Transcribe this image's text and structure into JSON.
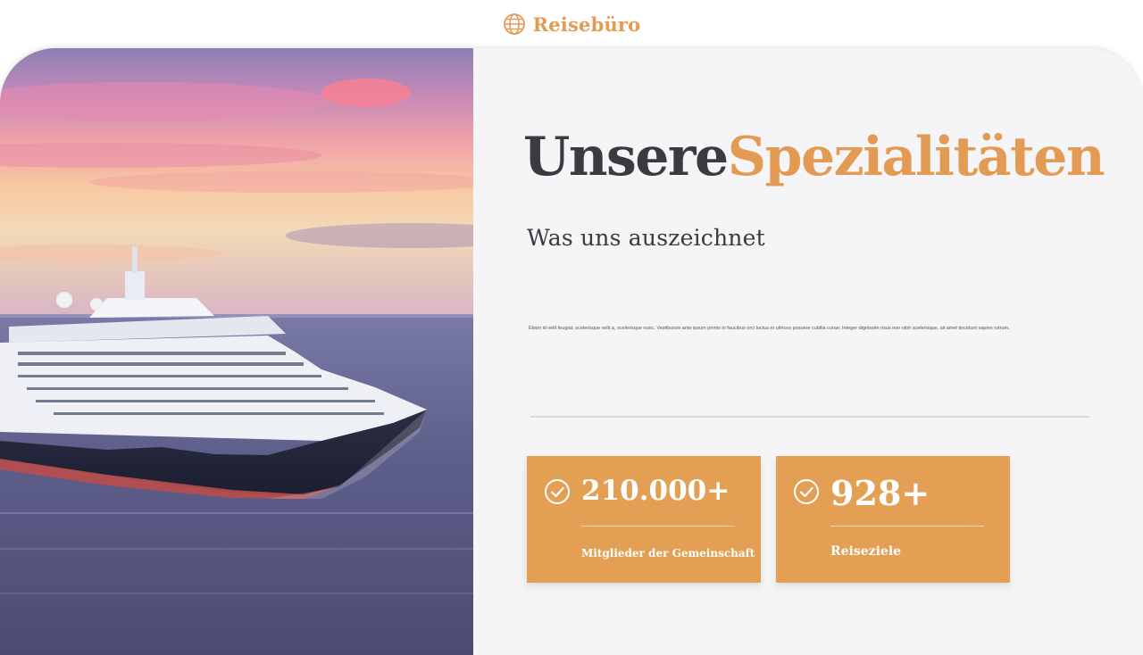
{
  "header": {
    "brand_name": "Reisebüro",
    "brand_icon": "globe-icon"
  },
  "hero": {
    "image": "cruise-ship-sunset"
  },
  "main": {
    "heading_part1": "Unsere",
    "heading_part2": "Spezialitäten",
    "subtitle": "Was uns auszeichnet",
    "body": "Etiam id velit feugiat, scelerisque velit a, scelerisque nunc. Vestibulum ante ipsum primis in faucibus orci luctus et ultrices posuere cubilia curae; Integer dignissim risus non nibh scelerisque, sit amet tincidunt sapien rutrum."
  },
  "stats": [
    {
      "value": "210.000+",
      "label": "Mitglieder der Gemeinschaft",
      "icon": "check-circle-icon"
    },
    {
      "value": "928+",
      "label": "Reiseziele",
      "icon": "check-circle-icon"
    }
  ],
  "colors": {
    "accent": "#e39a52",
    "dark_text": "#3b3b3f",
    "stat_card": "#e3a055",
    "panel_bg": "#f5f4f6"
  }
}
